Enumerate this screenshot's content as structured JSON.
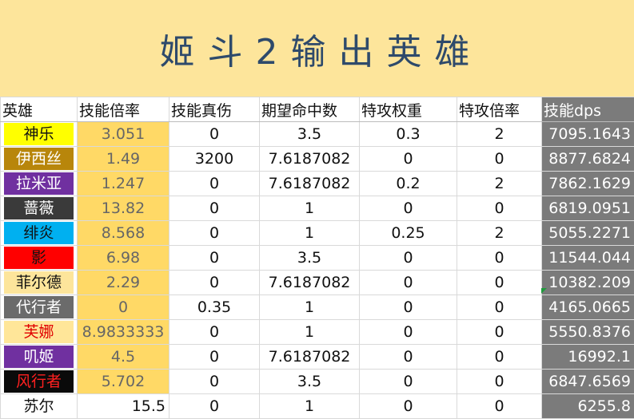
{
  "title": "姬斗2输出英雄",
  "headers": [
    "英雄",
    "技能倍率",
    "技能真伤",
    "期望命中数",
    "特攻权重",
    "特攻倍率",
    "技能dps"
  ],
  "rows": [
    {
      "hero": "神乐",
      "rate": "3.051",
      "true_dmg": "0",
      "hits": "3.5",
      "weight": "0.3",
      "mult": "2",
      "dps": "7095.1643",
      "bg": "#ffff00",
      "fg": "#111111"
    },
    {
      "hero": "伊西丝",
      "rate": "1.49",
      "true_dmg": "3200",
      "hits": "7.6187082",
      "weight": "0",
      "mult": "0",
      "dps": "8877.6824",
      "bg": "#b8860b",
      "fg": "#ffffff"
    },
    {
      "hero": "拉米亚",
      "rate": "1.247",
      "true_dmg": "0",
      "hits": "7.6187082",
      "weight": "0.2",
      "mult": "2",
      "dps": "7862.1629",
      "bg": "#7030a0",
      "fg": "#ffffff"
    },
    {
      "hero": "蔷薇",
      "rate": "13.82",
      "true_dmg": "0",
      "hits": "1",
      "weight": "0",
      "mult": "0",
      "dps": "6819.0951",
      "bg": "#3a3a3a",
      "fg": "#ffffff"
    },
    {
      "hero": "绯炎",
      "rate": "8.568",
      "true_dmg": "0",
      "hits": "1",
      "weight": "0.25",
      "mult": "2",
      "dps": "5055.2271",
      "bg": "#00b0f0",
      "fg": "#111111"
    },
    {
      "hero": "影",
      "rate": "6.98",
      "true_dmg": "0",
      "hits": "3.5",
      "weight": "0",
      "mult": "0",
      "dps": "11544.044",
      "bg": "#ff0000",
      "fg": "#111111"
    },
    {
      "hero": "菲尔德",
      "rate": "2.29",
      "true_dmg": "0",
      "hits": "7.6187082",
      "weight": "0",
      "mult": "0",
      "dps": "10382.209",
      "bg": "#fde59b",
      "fg": "#111111"
    },
    {
      "hero": "代行者",
      "rate": "0",
      "true_dmg": "0.35",
      "hits": "1",
      "weight": "0",
      "mult": "0",
      "dps": "4165.0665",
      "bg": "#6b6b6b",
      "fg": "#ffffff"
    },
    {
      "hero": "芙娜",
      "rate": "8.9833333",
      "true_dmg": "0",
      "hits": "1",
      "weight": "0",
      "mult": "0",
      "dps": "5550.8376",
      "bg": "#ffe699",
      "fg": "#e00000"
    },
    {
      "hero": "叽姬",
      "rate": "4.5",
      "true_dmg": "0",
      "hits": "7.6187082",
      "weight": "0",
      "mult": "0",
      "dps": "16992.1",
      "bg": "#7030a0",
      "fg": "#ffffff"
    },
    {
      "hero": "风行者",
      "rate": "5.702",
      "true_dmg": "0",
      "hits": "3.5",
      "weight": "0",
      "mult": "0",
      "dps": "6847.6569",
      "bg": "#0a0a0a",
      "fg": "#ff2020"
    },
    {
      "hero": "苏尔",
      "rate": "15.5",
      "true_dmg": "0",
      "hits": "1",
      "weight": "0",
      "mult": "0",
      "dps": "6255.8",
      "bg": "#ffffff",
      "fg": "#111111"
    }
  ]
}
